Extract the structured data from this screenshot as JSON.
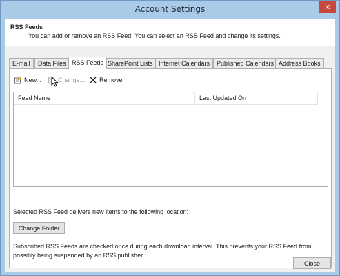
{
  "window": {
    "title": "Account Settings",
    "close_glyph": "✕"
  },
  "header": {
    "title": "RSS Feeds",
    "description": "You can add or remove an RSS Feed. You can select an RSS Feed and change its settings."
  },
  "tabs": [
    {
      "label": "E-mail",
      "active": false
    },
    {
      "label": "Data Files",
      "active": false
    },
    {
      "label": "RSS Feeds",
      "active": true
    },
    {
      "label": "SharePoint Lists",
      "active": false
    },
    {
      "label": "Internet Calendars",
      "active": false
    },
    {
      "label": "Published Calendars",
      "active": false
    },
    {
      "label": "Address Books",
      "active": false
    }
  ],
  "toolbar": {
    "new_label": "New...",
    "change_label": "Change...",
    "remove_label": "Remove"
  },
  "feeds_list": {
    "columns": [
      "Feed Name",
      "Last Updated On"
    ],
    "rows": []
  },
  "deliver_text": "Selected RSS Feed delivers new items to the following location:",
  "change_folder_label": "Change Folder",
  "note_text": "Subscribed RSS Feeds are checked once during each download interval. This prevents your RSS Feed from possibly being suspended by an RSS publisher.",
  "close_label": "Close",
  "colors": {
    "title_bar": "#a9cbe8",
    "close_button": "#c7463d",
    "dialog_background": "#f0f0f0"
  }
}
